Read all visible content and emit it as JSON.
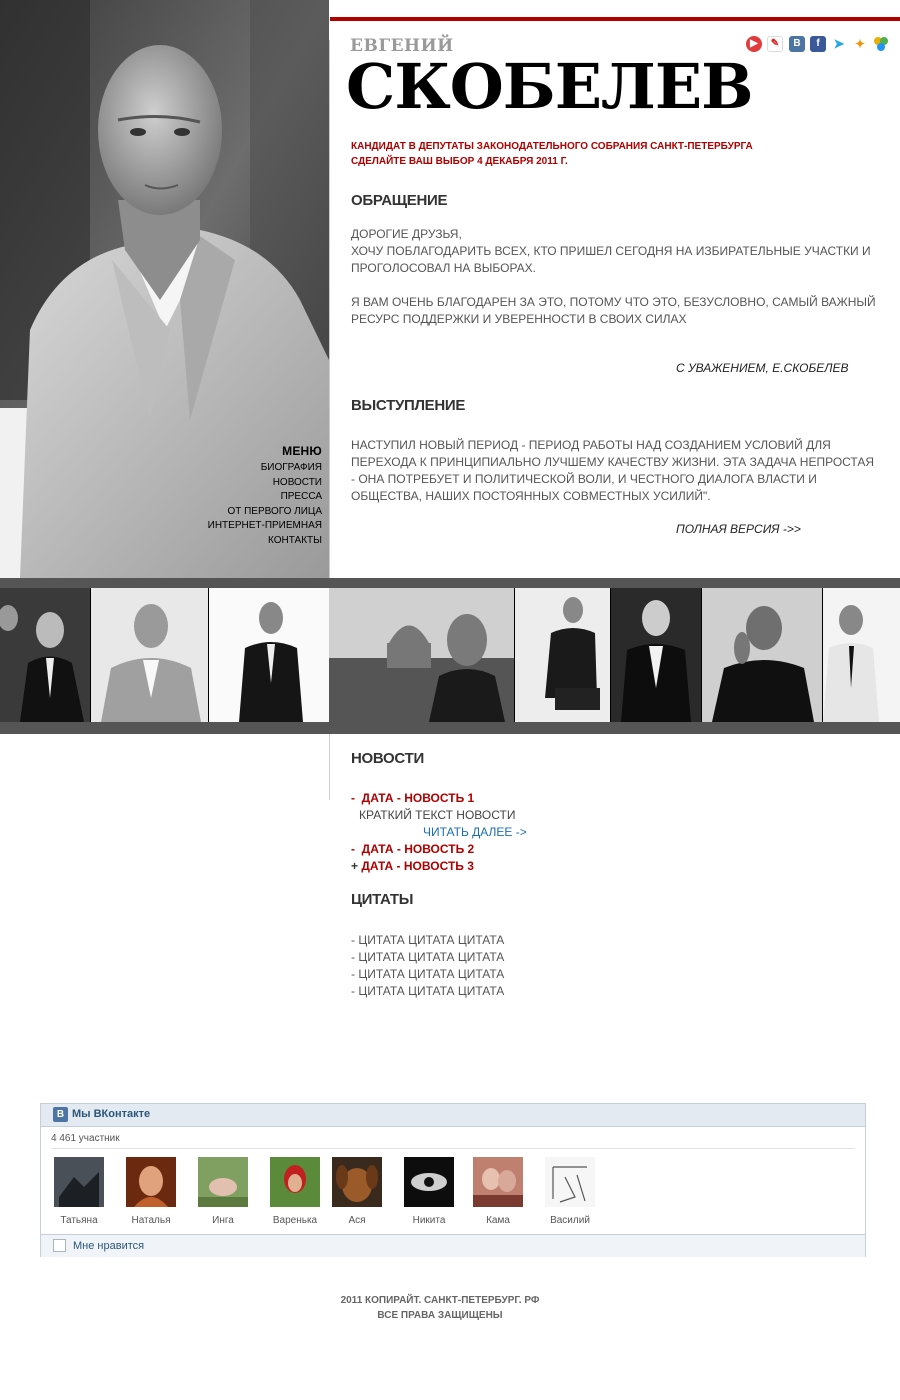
{
  "header": {
    "first_name": "ЕВГЕНИЙ",
    "last_name": "СКОБЕЛЕВ",
    "candidate_line1": "КАНДИДАТ В ДЕПУТАТЫ ЗАКОНОДАТЕЛЬНОГО СОБРАНИЯ САНКТ-ПЕТЕРБУРГА",
    "candidate_line2": "СДЕЛАЙТЕ ВАШ ВЫБОР 4 ДЕКАБРЯ 2011 Г."
  },
  "social_icons": [
    "youtube-icon",
    "livejournal-icon",
    "vkontakte-icon",
    "facebook-icon",
    "twitter-icon",
    "odnoklassniki-icon",
    "moimir-icon"
  ],
  "menu": {
    "title": "МЕНЮ",
    "items": [
      "БИОГРАФИЯ",
      "НОВОСТИ",
      "ПРЕССА",
      "ОТ ПЕРВОГО ЛИЦА",
      "ИНТЕРНЕТ-ПРИЕМНАЯ",
      "КОНТАКТЫ"
    ]
  },
  "appeal": {
    "title": "ОБРАЩЕНИЕ",
    "line1": "ДОРОГИЕ ДРУЗЬЯ,",
    "line2": "ХОЧУ ПОБЛАГОДАРИТЬ ВСЕХ, КТО ПРИШЕЛ СЕГОДНЯ НА ИЗБИРАТЕЛЬНЫЕ УЧАСТКИ И ПРОГОЛОСОВАЛ НА ВЫБОРАХ.",
    "line3": "Я ВАМ ОЧЕНЬ БЛАГОДАРЕН ЗА ЭТО, ПОТОМУ ЧТО ЭТО, БЕЗУСЛОВНО, САМЫЙ ВАЖНЫЙ РЕСУРС ПОДДЕРЖКИ И УВЕРЕННОСТИ В СВОИХ СИЛАХ",
    "signature": "С УВАЖЕНИЕМ, Е.СКОБЕЛЕВ"
  },
  "speech": {
    "title": "ВЫСТУПЛЕНИЕ",
    "text": "НАСТУПИЛ НОВЫЙ ПЕРИОД - ПЕРИОД РАБОТЫ НАД СОЗДАНИЕМ УСЛОВИЙ ДЛЯ ПЕРЕХОДА К ПРИНЦИПИАЛЬНО ЛУЧШЕМУ КАЧЕСТВУ ЖИЗНИ. ЭТА ЗАДАЧА НЕПРОСТАЯ - ОНА ПОТРЕБУЕТ И ПОЛИТИЧЕСКОЙ ВОЛИ, И ЧЕСТНОГО ДИАЛОГА ВЛАСТИ И ОБЩЕСТВА, НАШИХ ПОСТОЯННЫХ СОВМЕСТНЫХ УСИЛИЙ\".",
    "more": "ПОЛНАЯ ВЕРСИЯ ->>"
  },
  "news": {
    "title": "НОВОСТИ",
    "items": [
      {
        "prefix": "-",
        "label": "ДАТА - НОВОСТЬ 1",
        "brief": "КРАТКИЙ ТЕКСТ НОВОСТИ",
        "more": "ЧИТАТЬ ДАЛЕЕ ->"
      },
      {
        "prefix": "-",
        "label": "ДАТА - НОВОСТЬ 2"
      },
      {
        "prefix": "+",
        "label": "ДАТА - НОВОСТЬ 3"
      }
    ]
  },
  "quotes": {
    "title": "ЦИТАТЫ",
    "items": [
      "- ЦИТАТА ЦИТАТА ЦИТАТА",
      "- ЦИТАТА ЦИТАТА ЦИТАТА",
      "- ЦИТАТА ЦИТАТА ЦИТАТА",
      "- ЦИТАТА ЦИТАТА ЦИТАТА"
    ]
  },
  "vk_widget": {
    "logo": "В",
    "title": "Мы ВКонтакте",
    "count": "4 461 участник",
    "members": [
      "Татьяна",
      "Наталья",
      "Инга",
      "Варенька",
      "Ася",
      "Никита",
      "Кама",
      "Василий"
    ],
    "like": "Мне нравится"
  },
  "footer": {
    "line1": "2011 КОПИРАЙТ. САНКТ-ПЕТЕРБУРГ. РФ",
    "line2": "ВСЕ ПРАВА ЗАЩИЩЕНЫ"
  },
  "colors": {
    "accent": "#b00000",
    "link_blue": "#1a6fb0",
    "strip": "#555555"
  }
}
